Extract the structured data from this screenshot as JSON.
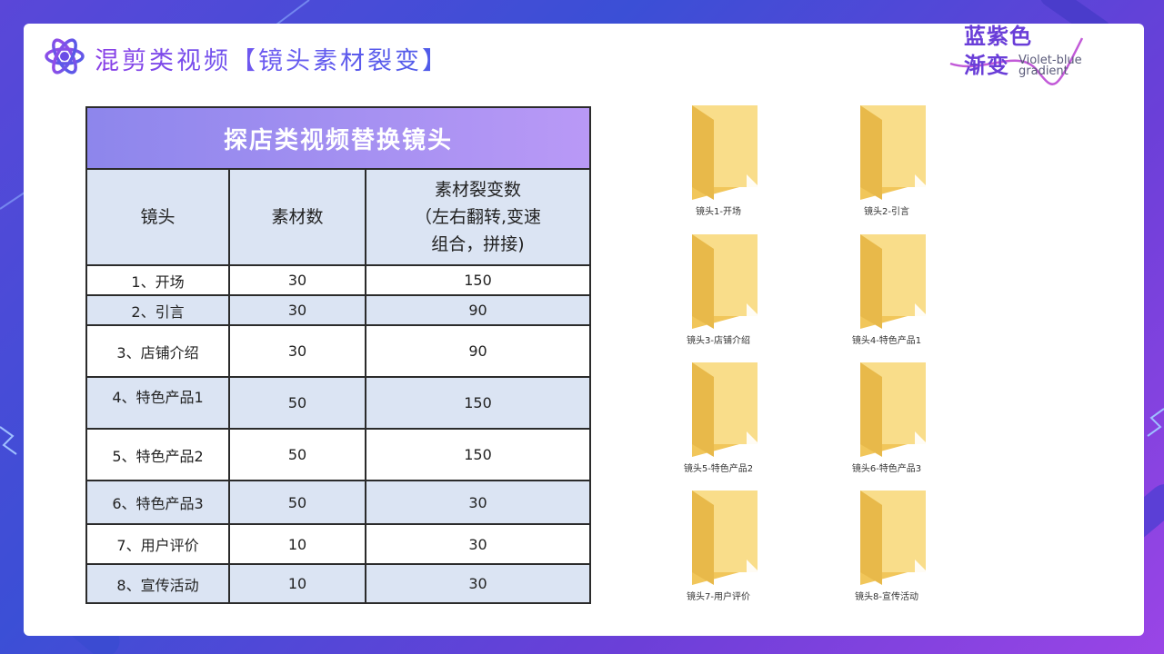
{
  "header": {
    "title": "混剪类视频【镜头素材裂变】"
  },
  "brand": {
    "cn_line1": "蓝紫色",
    "cn_line2": "渐变",
    "en_line1": "Violet-blue",
    "en_line2": "gradient"
  },
  "table": {
    "caption": "探店类视频替换镜头",
    "headers": [
      "镜头",
      "素材数",
      "素材裂变数",
      "（左右翻转,变速",
      "组合，拼接)"
    ],
    "rows": [
      {
        "shot": "1、开场",
        "count": "30",
        "fission": "150"
      },
      {
        "shot": "2、引言",
        "count": "30",
        "fission": "90"
      },
      {
        "shot": "3、店铺介绍",
        "count": "30",
        "fission": "90"
      },
      {
        "shot": "4、特色产品1",
        "count": "50",
        "fission": "150"
      },
      {
        "shot": "5、特色产品2",
        "count": "50",
        "fission": "150"
      },
      {
        "shot": "6、特色产品3",
        "count": "50",
        "fission": "30"
      },
      {
        "shot": "7、用户评价",
        "count": "10",
        "fission": "30"
      },
      {
        "shot": "8、宣传活动",
        "count": "10",
        "fission": "30"
      }
    ]
  },
  "folders": [
    "镜头1-开场",
    "镜头2-引言",
    "镜头3-店铺介绍",
    "镜头4-特色产品1",
    "镜头5-特色产品2",
    "镜头6-特色产品3",
    "镜头7-用户评价",
    "镜头8-宣传活动"
  ],
  "colors": {
    "accent_purple": "#8a3fe6",
    "accent_blue": "#4d5be8",
    "table_band": "#dbe4f3",
    "folder_yellow": "#f6d57a"
  }
}
